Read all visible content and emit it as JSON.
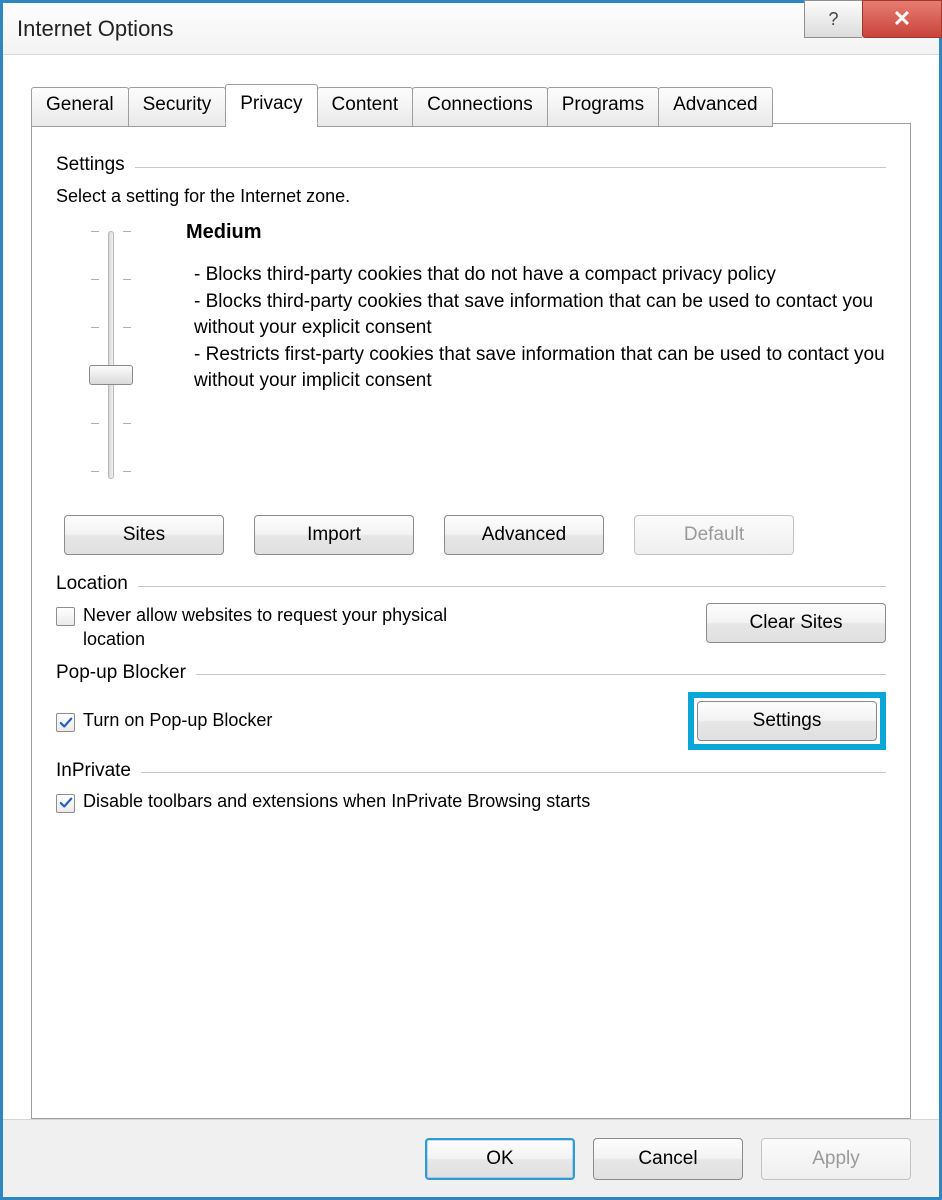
{
  "title": "Internet Options",
  "tabs": [
    "General",
    "Security",
    "Privacy",
    "Content",
    "Connections",
    "Programs",
    "Advanced"
  ],
  "active_tab": "Privacy",
  "settings": {
    "header": "Settings",
    "desc": "Select a setting for the Internet zone.",
    "level_name": "Medium",
    "bullets": [
      "- Blocks third-party cookies that do not have a compact privacy policy",
      "- Blocks third-party cookies that save information that can be used to contact you without your explicit consent",
      "- Restricts first-party cookies that save information that can be used to contact you without your implicit consent"
    ],
    "buttons": {
      "sites": "Sites",
      "import": "Import",
      "advanced": "Advanced",
      "default": "Default"
    }
  },
  "location": {
    "header": "Location",
    "checkbox_label": "Never allow websites to request your physical location",
    "checked": false,
    "clear_sites": "Clear Sites"
  },
  "popup": {
    "header": "Pop-up Blocker",
    "checkbox_label": "Turn on Pop-up Blocker",
    "checked": true,
    "settings_btn": "Settings"
  },
  "inprivate": {
    "header": "InPrivate",
    "checkbox_label": "Disable toolbars and extensions when InPrivate Browsing starts",
    "checked": true
  },
  "footer": {
    "ok": "OK",
    "cancel": "Cancel",
    "apply": "Apply"
  }
}
